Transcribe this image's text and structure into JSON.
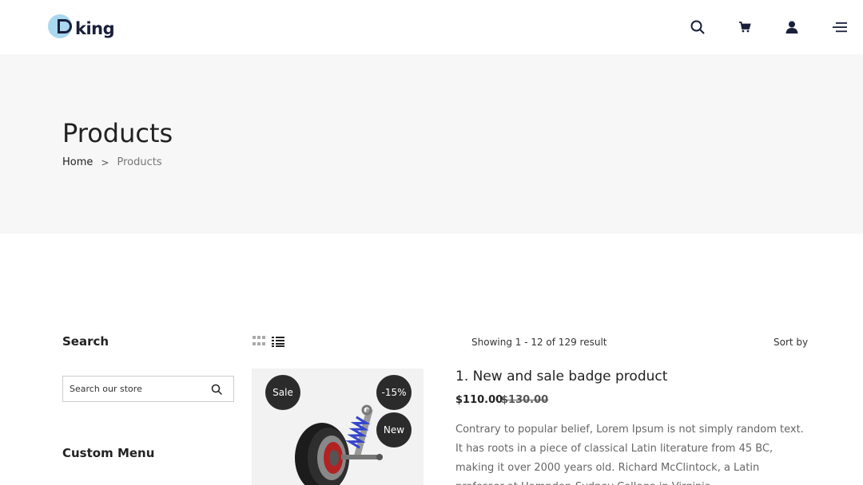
{
  "header": {
    "logo_text": "king",
    "icons": [
      "search-icon",
      "cart-icon",
      "user-icon",
      "menu-icon"
    ]
  },
  "hero": {
    "title": "Products",
    "breadcrumb": {
      "home": "Home",
      "separator": ">",
      "current": "Products"
    }
  },
  "sidebar": {
    "search_heading": "Search",
    "search_placeholder": "Search our store",
    "custom_menu_heading": "Custom Menu"
  },
  "toolbar": {
    "showing": "Showing 1 - 12 of 129 result",
    "sort_label": "Sort by"
  },
  "product": {
    "badges": {
      "sale": "Sale",
      "discount": "-15%",
      "new": "New"
    },
    "title": "1. New and sale badge product",
    "price_new": "$110.00",
    "price_old": "$130.00",
    "description": "Contrary to popular belief, Lorem Ipsum is not simply random text. It has roots in a piece of classical Latin literature from 45 BC, making it over 2000 years old. Richard McClintock, a Latin professor at Hampden-Sydney College in Virginia"
  },
  "colors": {
    "hero_bg": "#f7f7f7",
    "badge_bg": "#2b2b2b",
    "logo_accent": "#a9d8f0",
    "logo_dark": "#1a1f3a"
  }
}
